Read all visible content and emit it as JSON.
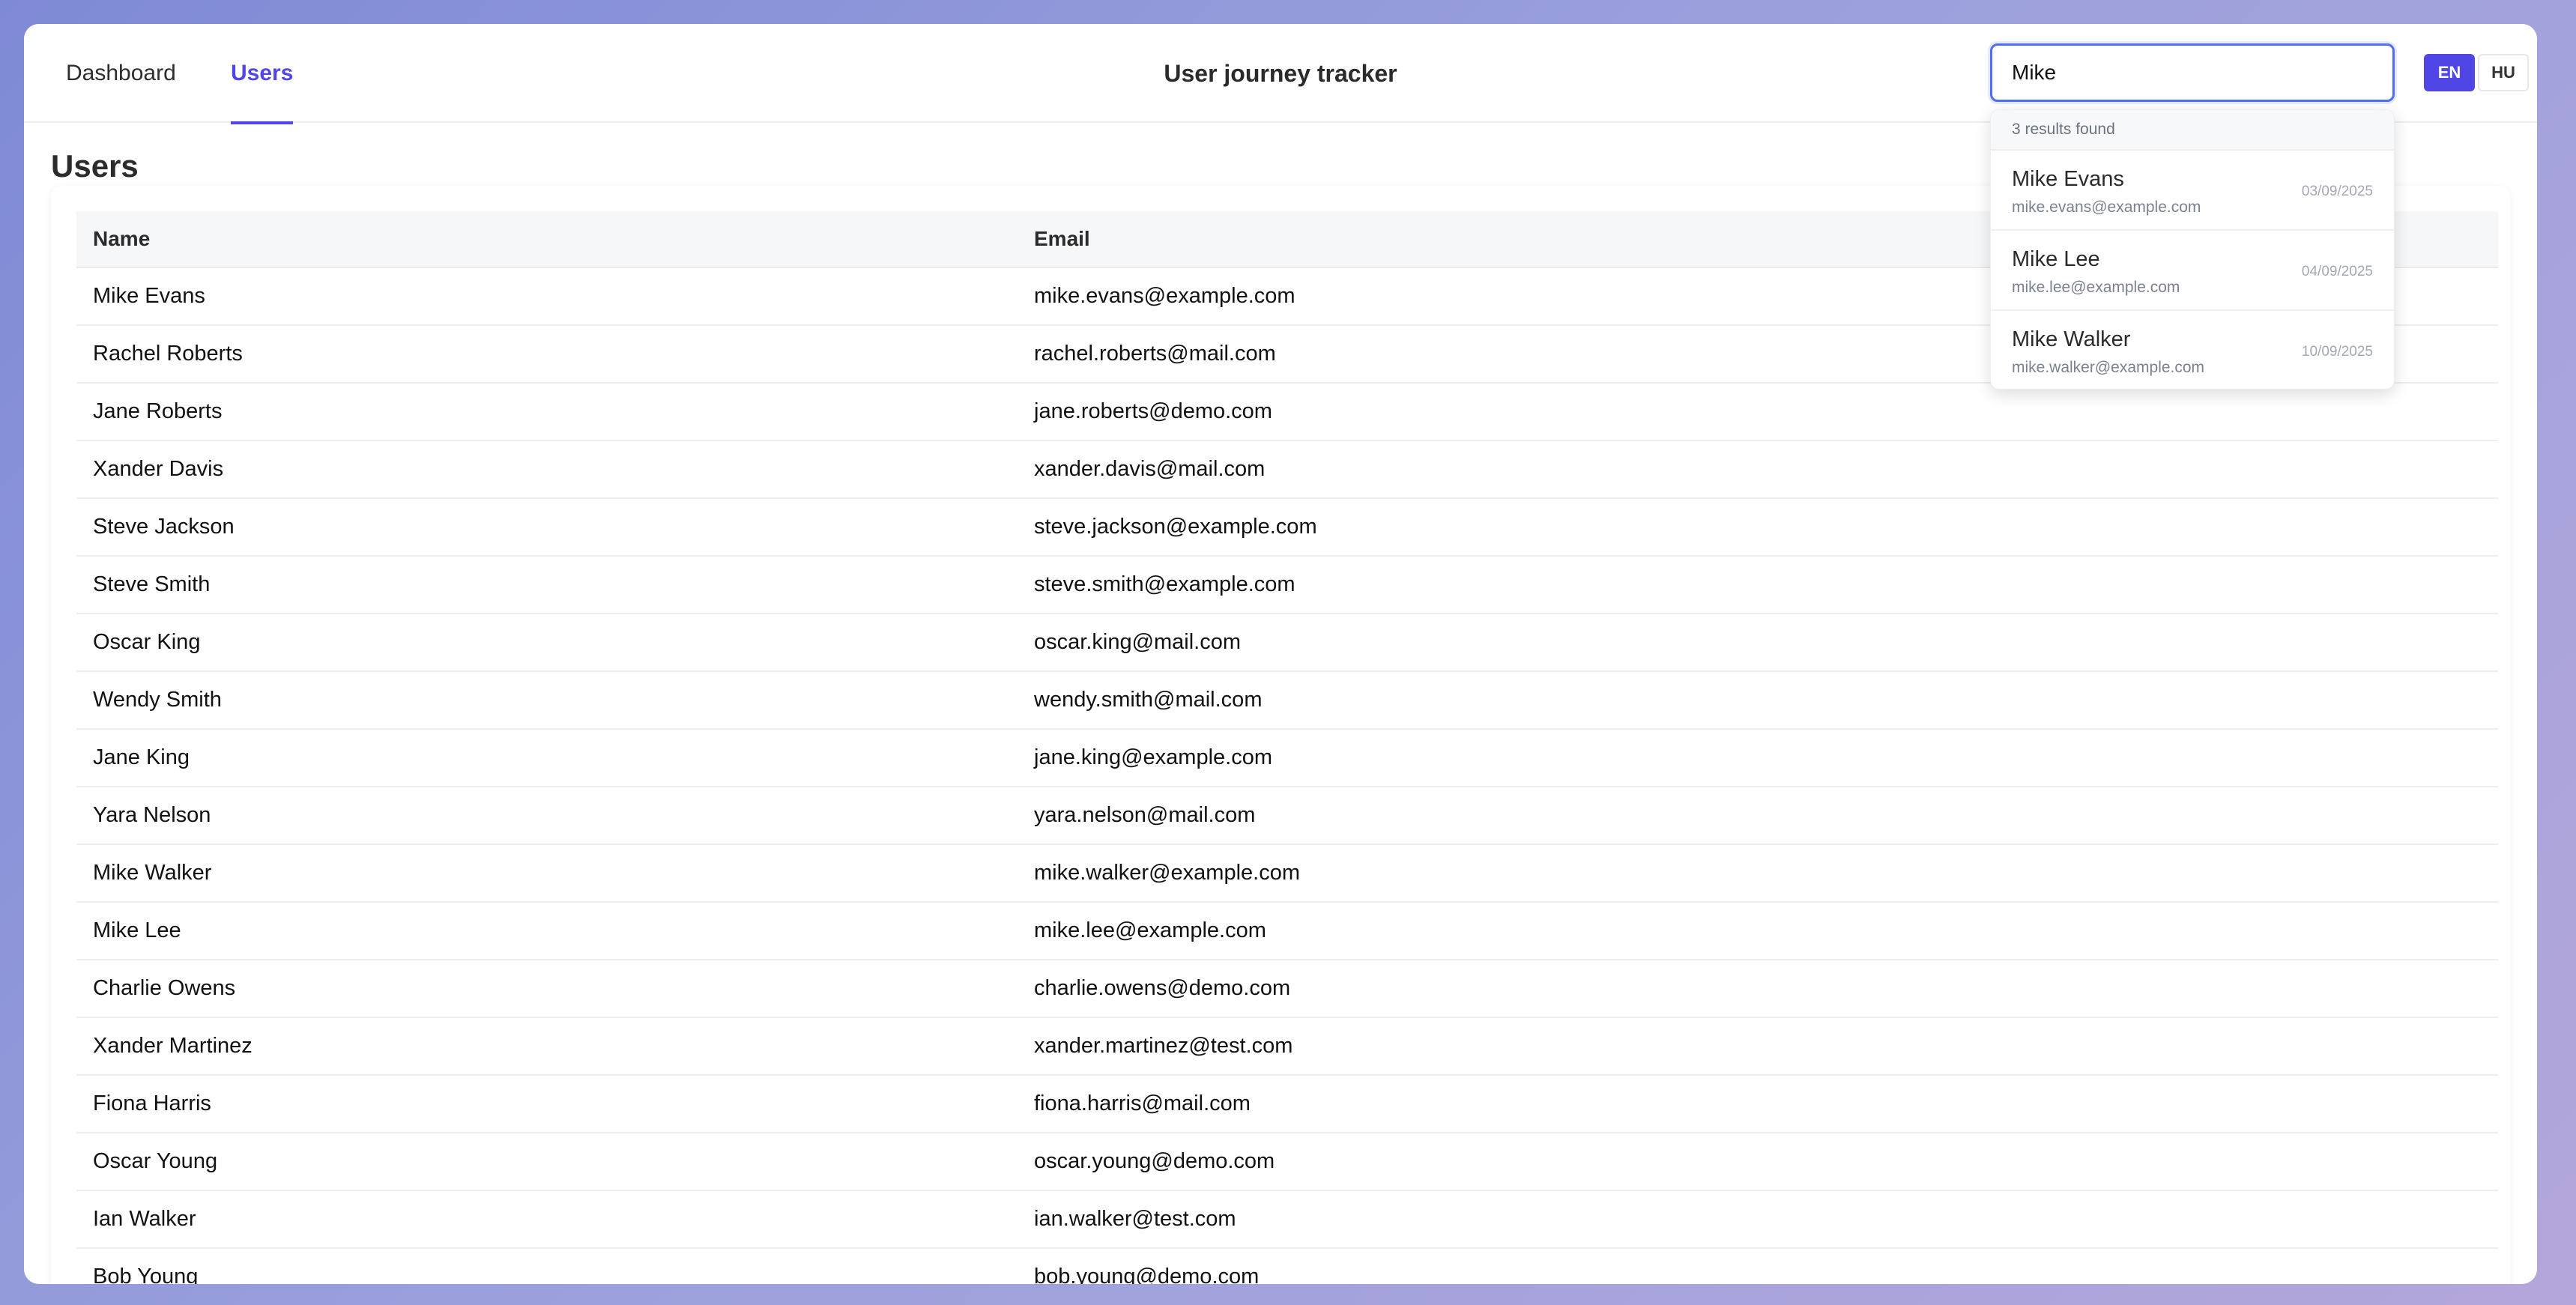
{
  "nav": {
    "tabs": [
      {
        "label": "Dashboard"
      },
      {
        "label": "Users"
      }
    ]
  },
  "header": {
    "title": "User journey tracker"
  },
  "search": {
    "value": "Mike",
    "placeholder": ""
  },
  "lang": {
    "en": "EN",
    "hu": "HU",
    "active": "EN"
  },
  "page": {
    "title": "Users"
  },
  "table": {
    "columns": [
      "Name",
      "Email"
    ],
    "rows": [
      {
        "name": "Mike Evans",
        "email": "mike.evans@example.com"
      },
      {
        "name": "Rachel Roberts",
        "email": "rachel.roberts@mail.com"
      },
      {
        "name": "Jane Roberts",
        "email": "jane.roberts@demo.com"
      },
      {
        "name": "Xander Davis",
        "email": "xander.davis@mail.com"
      },
      {
        "name": "Steve Jackson",
        "email": "steve.jackson@example.com"
      },
      {
        "name": "Steve Smith",
        "email": "steve.smith@example.com"
      },
      {
        "name": "Oscar King",
        "email": "oscar.king@mail.com"
      },
      {
        "name": "Wendy Smith",
        "email": "wendy.smith@mail.com"
      },
      {
        "name": "Jane King",
        "email": "jane.king@example.com"
      },
      {
        "name": "Yara Nelson",
        "email": "yara.nelson@mail.com"
      },
      {
        "name": "Mike Walker",
        "email": "mike.walker@example.com"
      },
      {
        "name": "Mike Lee",
        "email": "mike.lee@example.com"
      },
      {
        "name": "Charlie Owens",
        "email": "charlie.owens@demo.com"
      },
      {
        "name": "Xander Martinez",
        "email": "xander.martinez@test.com"
      },
      {
        "name": "Fiona Harris",
        "email": "fiona.harris@mail.com"
      },
      {
        "name": "Oscar Young",
        "email": "oscar.young@demo.com"
      },
      {
        "name": "Ian Walker",
        "email": "ian.walker@test.com"
      },
      {
        "name": "Bob Young",
        "email": "bob.young@demo.com"
      }
    ]
  },
  "dropdown": {
    "summary": "3 results found",
    "results": [
      {
        "name": "Mike Evans",
        "email": "mike.evans@example.com",
        "date": "03/09/2025"
      },
      {
        "name": "Mike Lee",
        "email": "mike.lee@example.com",
        "date": "04/09/2025"
      },
      {
        "name": "Mike Walker",
        "email": "mike.walker@example.com",
        "date": "10/09/2025"
      }
    ]
  },
  "colors": {
    "accent": "#4f46e5",
    "focus": "#4f6df5"
  }
}
